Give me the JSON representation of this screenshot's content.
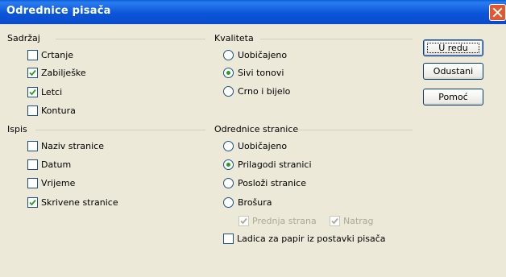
{
  "window": {
    "title": "Odrednice pisača"
  },
  "content": {
    "heading": "Sadržaj",
    "items": [
      {
        "label": "Crtanje",
        "checked": false
      },
      {
        "label": "Zabilješke",
        "checked": true
      },
      {
        "label": "Letci",
        "checked": true
      },
      {
        "label": "Kontura",
        "checked": false
      }
    ]
  },
  "quality": {
    "heading": "Kvaliteta",
    "options": [
      "Uobičajeno",
      "Sivi tonovi",
      "Crno i bijelo"
    ],
    "selected": "Sivi tonovi"
  },
  "print": {
    "heading": "Ispis",
    "items": [
      {
        "label": "Naziv stranice",
        "checked": false
      },
      {
        "label": "Datum",
        "checked": false
      },
      {
        "label": "Vrijeme",
        "checked": false
      },
      {
        "label": "Skrivene stranice",
        "checked": true
      }
    ]
  },
  "page_options": {
    "heading": "Odrednice stranice",
    "options": [
      "Uobičajeno",
      "Prilagodi stranici",
      "Posloži stranice",
      "Brošura"
    ],
    "selected": "Prilagodi stranici",
    "brochure": {
      "front_label": "Prednja strana",
      "front_checked": true,
      "back_label": "Natrag",
      "back_checked": true
    },
    "paper_tray_label": "Ladica za papir iz postavki pisača",
    "paper_tray_checked": false
  },
  "buttons": {
    "ok": "U redu",
    "cancel": "Odustani",
    "help": "Pomoć"
  },
  "colors": {
    "titlebar": "#0a5fd9",
    "dialog_bg": "#ece9d8",
    "close_button": "#e2572c",
    "radio_dot": "#21a121"
  }
}
